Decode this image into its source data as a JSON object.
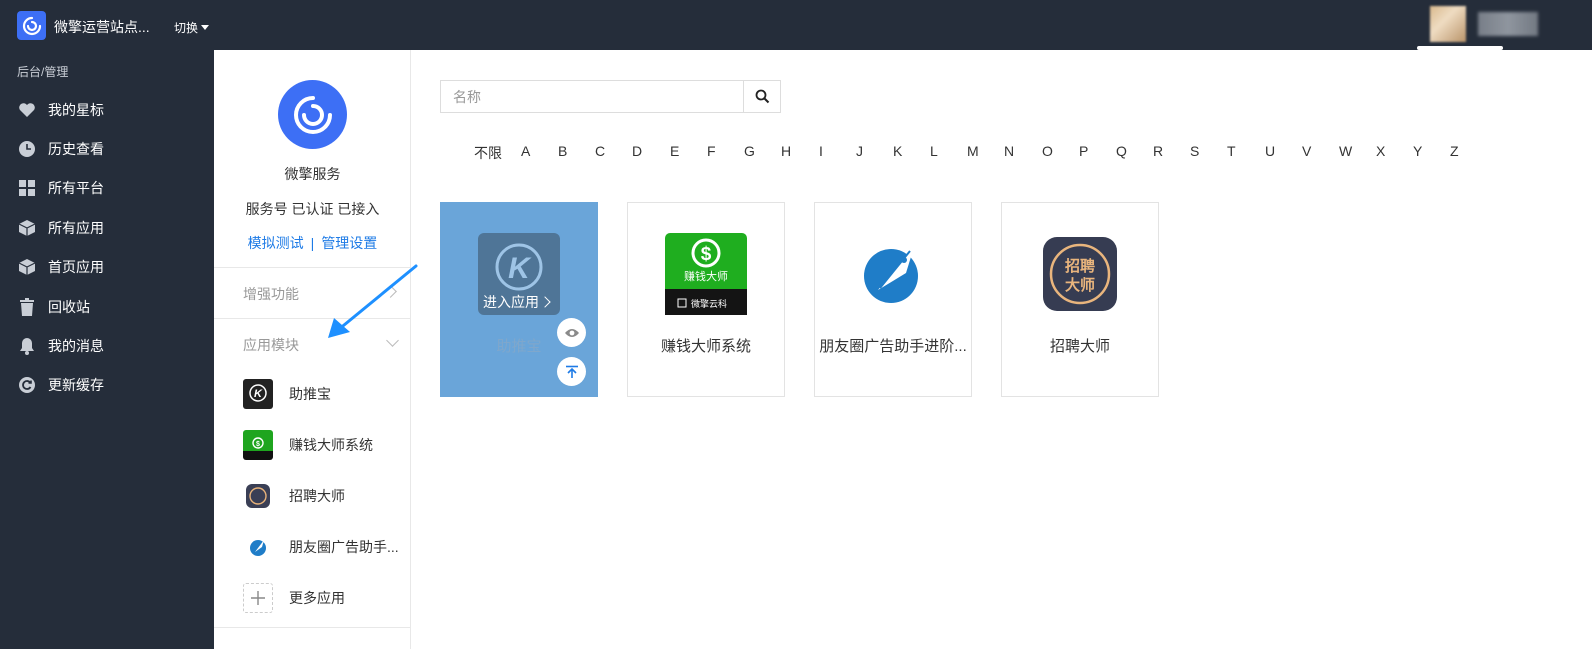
{
  "topbar": {
    "site_title": "微擎运营站点...",
    "switch_label": "切换"
  },
  "sidebar": {
    "breadcrumb": "后台/管理",
    "items": [
      {
        "label": "我的星标",
        "icon": "heart-icon"
      },
      {
        "label": "历史查看",
        "icon": "clock-icon"
      },
      {
        "label": "所有平台",
        "icon": "grid-icon"
      },
      {
        "label": "所有应用",
        "icon": "cube-icon"
      },
      {
        "label": "首页应用",
        "icon": "cube-icon"
      },
      {
        "label": "回收站",
        "icon": "trash-icon"
      },
      {
        "label": "我的消息",
        "icon": "bell-icon"
      },
      {
        "label": "更新缓存",
        "icon": "refresh-icon"
      }
    ]
  },
  "panel": {
    "service_name": "微擎服务",
    "status": "服务号 已认证 已接入",
    "link_test": "模拟测试",
    "link_sep": "|",
    "link_manage": "管理设置",
    "section_enhance": "增强功能",
    "section_modules": "应用模块",
    "modules": [
      {
        "label": "助推宝",
        "icon": "zhutuibao-icon"
      },
      {
        "label": "赚钱大师系统",
        "icon": "money-master-icon"
      },
      {
        "label": "招聘大师",
        "icon": "recruit-master-icon"
      },
      {
        "label": "朋友圈广告助手...",
        "icon": "rocket-icon"
      },
      {
        "label": "更多应用",
        "icon": "plus-icon"
      }
    ]
  },
  "main": {
    "search_placeholder": "名称",
    "letters": [
      "不限",
      "A",
      "B",
      "C",
      "D",
      "E",
      "F",
      "G",
      "H",
      "I",
      "J",
      "K",
      "L",
      "M",
      "N",
      "O",
      "P",
      "Q",
      "R",
      "S",
      "T",
      "U",
      "V",
      "W",
      "X",
      "Y",
      "Z"
    ],
    "cards": [
      {
        "title": "助推宝",
        "enter_label": "进入应用"
      },
      {
        "title": "赚钱大师系统",
        "icon_text_top": "赚钱大师",
        "icon_text_bottom": "微擎云科"
      },
      {
        "title": "朋友圈广告助手进阶..."
      },
      {
        "title": "招聘大师",
        "icon_text_1": "招聘",
        "icon_text_2": "大师"
      }
    ]
  },
  "colors": {
    "topbar_bg": "#252d3a",
    "accent": "#3d6ff5",
    "link": "#1e7be6",
    "active_card": "#6aa5d9"
  }
}
